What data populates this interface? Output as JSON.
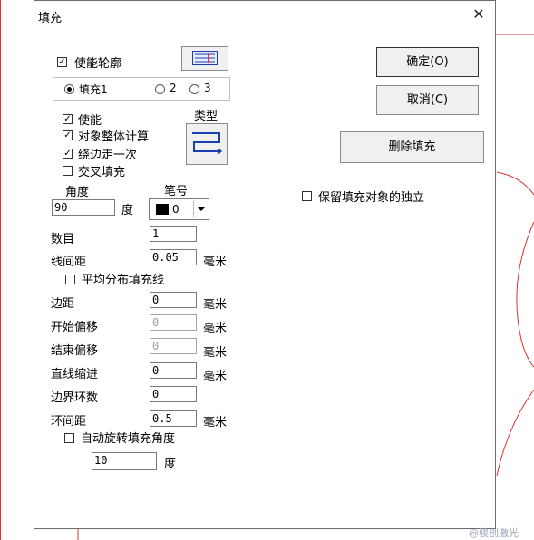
{
  "dialog": {
    "title": "填充",
    "close_glyph": "✕"
  },
  "contour": {
    "enable_label": "使能轮廓",
    "enable_checked": true,
    "radio_options": [
      "填充1",
      "2",
      "3"
    ],
    "radio_selected": 0
  },
  "fill": {
    "enable_label": "使能",
    "whole_calc_label": "对象整体计算",
    "edge_once_label": "绕边走一次",
    "cross_fill_label": "交叉填充",
    "enable_checked": true,
    "whole_calc_checked": true,
    "edge_once_checked": true,
    "cross_fill_checked": false,
    "type_label": "类型",
    "angle_label": "角度",
    "angle_value": "90",
    "angle_unit": "度",
    "pen_label": "笔号",
    "pen_value": "0",
    "pen_color": "#000000",
    "count_label": "数目",
    "count_value": "1",
    "line_spacing_label": "线间距",
    "line_spacing_value": "0.05",
    "unit_mm": "毫米",
    "even_distribute_label": "平均分布填充线",
    "even_distribute_checked": false,
    "margin_label": "边距",
    "margin_value": "0",
    "start_offset_label": "开始偏移",
    "start_offset_value": "0",
    "end_offset_label": "结束偏移",
    "end_offset_value": "0",
    "line_indent_label": "直线缩进",
    "line_indent_value": "0",
    "border_loops_label": "边界环数",
    "border_loops_value": "0",
    "loop_spacing_label": "环间距",
    "loop_spacing_value": "0.5",
    "auto_rotate_label": "自动旋转填充角度",
    "auto_rotate_checked": false,
    "auto_rotate_value": "10",
    "auto_rotate_unit": "度"
  },
  "buttons": {
    "ok": "确定(O)",
    "cancel": "取消(C)",
    "delete_fill": "删除填充"
  },
  "keep_independent": {
    "label": "保留填充对象的独立",
    "checked": false
  },
  "watermark": "@骏创激光",
  "colors": {
    "accent_red": "#e03030",
    "icon_blue": "#1a3fb0"
  }
}
